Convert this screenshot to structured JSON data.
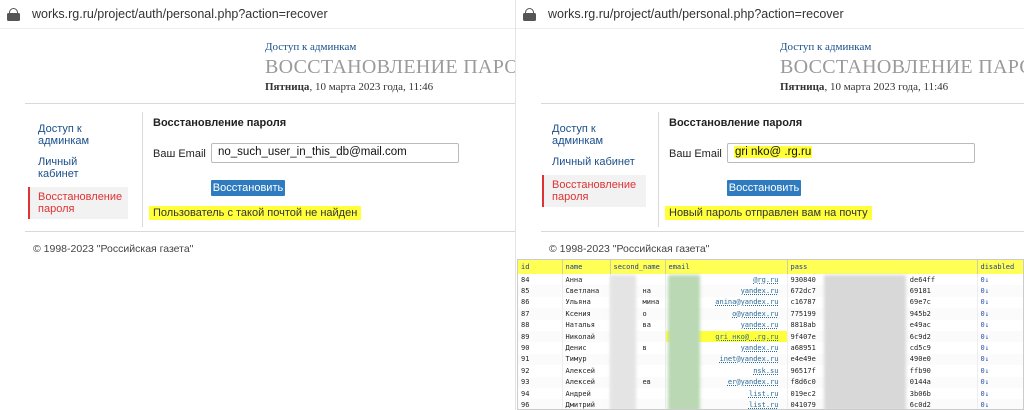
{
  "left": {
    "url": "works.rg.ru/project/auth/personal.php?action=recover",
    "header": {
      "admin_link": "Доступ к админкам",
      "title": "ВОССТАНОВЛЕНИЕ ПАРОЛЯ",
      "date_day": "Пятница",
      "date_rest": ", 10 марта 2023 года, 11:46"
    },
    "menu": [
      "Доступ к админкам",
      "Личный кабинет",
      "Восстановление пароля"
    ],
    "form": {
      "title": "Восстановление пароля",
      "email_label": "Ваш Email",
      "email_value": "no_such_user_in_this_db@mail.com",
      "button": "Восстановить",
      "message": "Пользователь с такой почтой не найден"
    },
    "footer": "© 1998-2023 \"Российская газета\""
  },
  "right": {
    "url": "works.rg.ru/project/auth/personal.php?action=recover",
    "header": {
      "admin_link": "Доступ к админкам",
      "title": "ВОССТАНОВЛЕНИЕ ПАРОЛЯ",
      "date_day": "Пятница",
      "date_rest": ", 10 марта 2023 года, 11:46"
    },
    "menu": [
      "Доступ к админкам",
      "Личный кабинет",
      "Восстановление пароля"
    ],
    "form": {
      "title": "Восстановление пароля",
      "email_label": "Ваш Email",
      "email_value": "gri   nko@      .rg.ru",
      "button": "Восстановить",
      "message": "Новый пароль отправлен вам на почту"
    },
    "footer": "© 1998-2023 \"Российская газета\""
  },
  "dump": {
    "columns": [
      "id",
      "name",
      "second_name",
      "email",
      "pass",
      "disabled"
    ],
    "rows": [
      {
        "id": "84",
        "name": "Анна",
        "second": "",
        "email": "@rg.ru",
        "pass_a": "930840",
        "pass_b": "de64ff",
        "dis": "0↓"
      },
      {
        "id": "85",
        "name": "Светлана",
        "second": "на",
        "email": "yandex.ru",
        "pass_a": "672dc7",
        "pass_b": "69181",
        "dis": "0↓"
      },
      {
        "id": "86",
        "name": "Ульяна",
        "second": "мина",
        "email": "anina@yandex.ru",
        "pass_a": "c16787",
        "pass_b": "69e7c",
        "dis": "0↓"
      },
      {
        "id": "87",
        "name": "Ксения",
        "second": "о",
        "email": "o@yandex.ru",
        "pass_a": "775199",
        "pass_b": "945b2",
        "dis": "0↓"
      },
      {
        "id": "88",
        "name": "Наталья",
        "second": "ва",
        "email": "yandex.ru",
        "pass_a": "8818ab",
        "pass_b": "e49ac",
        "dis": "0↓"
      },
      {
        "id": "89",
        "name": "Николай",
        "second": "",
        "email": "gri    нко@      .rg.ru",
        "pass_a": "9f407e",
        "pass_b": "6c9d2",
        "dis": "0↓",
        "hl": true
      },
      {
        "id": "90",
        "name": "Денис",
        "second": "в",
        "email": "yandex.ru",
        "pass_a": "a68951",
        "pass_b": "cd5c9",
        "dis": "0↓"
      },
      {
        "id": "91",
        "name": "Тимур",
        "second": "",
        "email": "inet@yandex.ru",
        "pass_a": "e4e49e",
        "pass_b": "490e0",
        "dis": "0↓"
      },
      {
        "id": "92",
        "name": "Алексей",
        "second": "",
        "email": "nsk.su",
        "pass_a": "96517f",
        "pass_b": "ffb90",
        "dis": "0↓"
      },
      {
        "id": "93",
        "name": "Алексей",
        "second": "ев",
        "email": "er@yandex.ru",
        "pass_a": "f8d6c0",
        "pass_b": "0144a",
        "dis": "0↓"
      },
      {
        "id": "94",
        "name": "Андрей",
        "second": "",
        "email": "list.ru",
        "pass_a": "019ec2",
        "pass_b": "3b06b",
        "dis": "0↓"
      },
      {
        "id": "96",
        "name": "Дмитрий",
        "second": "",
        "email": "list.ru",
        "pass_a": "041079",
        "pass_b": "6c0d2",
        "dis": "0↓"
      }
    ]
  }
}
